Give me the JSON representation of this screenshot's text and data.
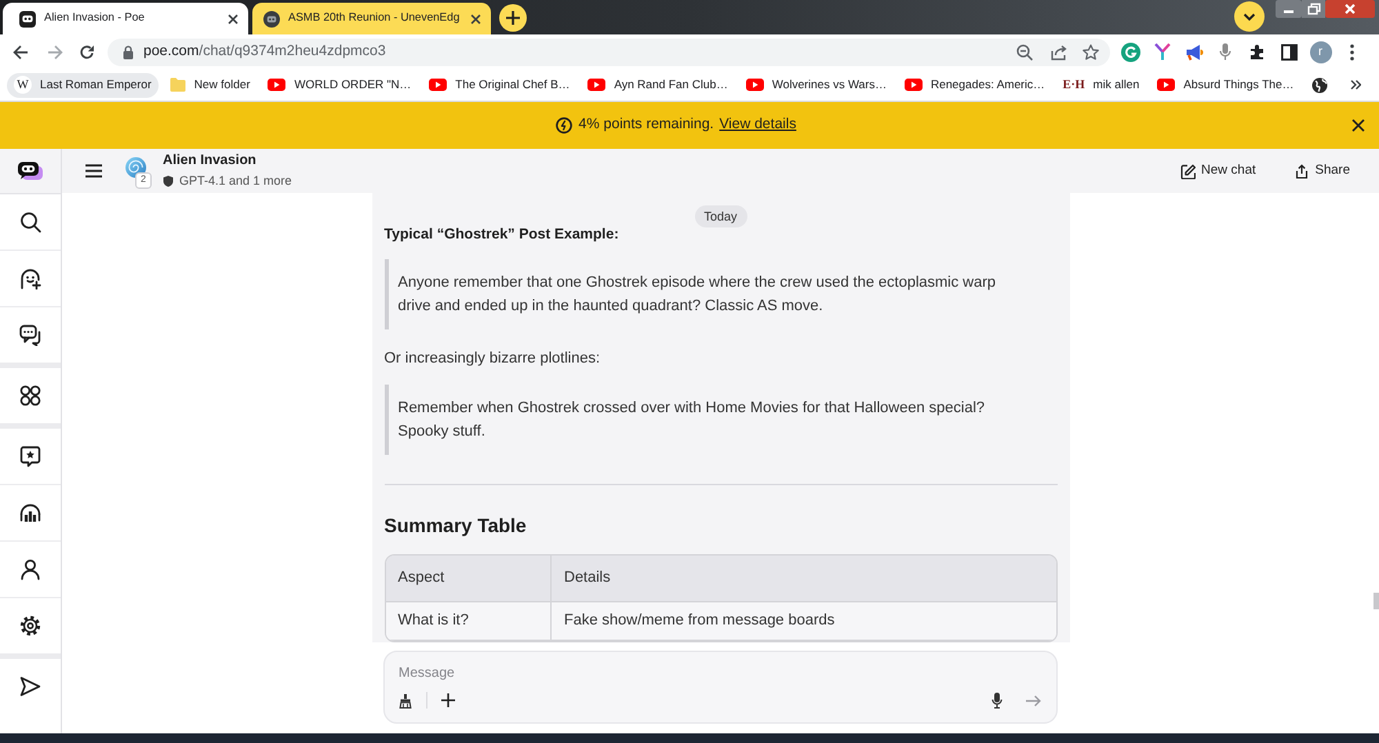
{
  "browser": {
    "tabs": [
      {
        "kind": "bot",
        "title": "Alien Invasion - Poe",
        "selected": true
      },
      {
        "kind": "site",
        "title": "ASMB 20th Reunion - UnevenEdg",
        "selected": false
      }
    ],
    "address": {
      "host": "poe.com",
      "path": "/chat/q9374m2heu4zdpmco3"
    },
    "profile_initial": "r",
    "bookmarks": [
      {
        "kind": "wiki",
        "icon_text": "W",
        "label": "Last Roman Emperor",
        "highlighted": true
      },
      {
        "kind": "folder",
        "label": "New folder",
        "highlighted": false
      },
      {
        "kind": "video",
        "label": "WORLD ORDER \"N…",
        "highlighted": false
      },
      {
        "kind": "video",
        "label": "The Original Chef B…",
        "highlighted": false
      },
      {
        "kind": "video",
        "label": "Ayn Rand Fan Club…",
        "highlighted": false
      },
      {
        "kind": "video",
        "label": "Wolverines vs Wars…",
        "highlighted": false
      },
      {
        "kind": "video",
        "label": "Renegades: Americ…",
        "highlighted": false
      },
      {
        "kind": "monogram",
        "icon_text": "E·H",
        "label": "mik allen",
        "highlighted": false
      },
      {
        "kind": "video",
        "label": "Absurd Things The…",
        "highlighted": false
      },
      {
        "kind": "globe",
        "highlighted": false
      }
    ]
  },
  "banner": {
    "text": "4% points remaining.",
    "link": "View details"
  },
  "chat_header": {
    "title": "Alien Invasion",
    "subtitle": "GPT-4.1 and 1 more",
    "bot_count": "2",
    "actions": [
      {
        "kind": "new_chat",
        "label": "New chat"
      },
      {
        "kind": "share",
        "label": "Share"
      }
    ]
  },
  "messages": {
    "date": "Today",
    "blocks": [
      {
        "kind": "heading",
        "text": "Typical “Ghostrek” Post Example:"
      },
      {
        "kind": "quote",
        "text": "Anyone remember that one Ghostrek episode where the crew used the ectoplasmic warp drive and ended up in the haunted quadrant? Classic AS move."
      },
      {
        "kind": "paragraph",
        "text": "Or increasingly bizarre plotlines:"
      },
      {
        "kind": "quote",
        "text": "Remember when Ghostrek crossed over with Home Movies for that Halloween special? Spooky stuff."
      },
      {
        "kind": "rule"
      },
      {
        "kind": "title",
        "text": "Summary Table"
      },
      {
        "kind": "table",
        "columns": [
          "Aspect",
          "Details"
        ],
        "rows": [
          [
            "What is it?",
            "Fake show/meme from message boards"
          ]
        ]
      }
    ]
  },
  "composer": {
    "placeholder": "Message"
  }
}
